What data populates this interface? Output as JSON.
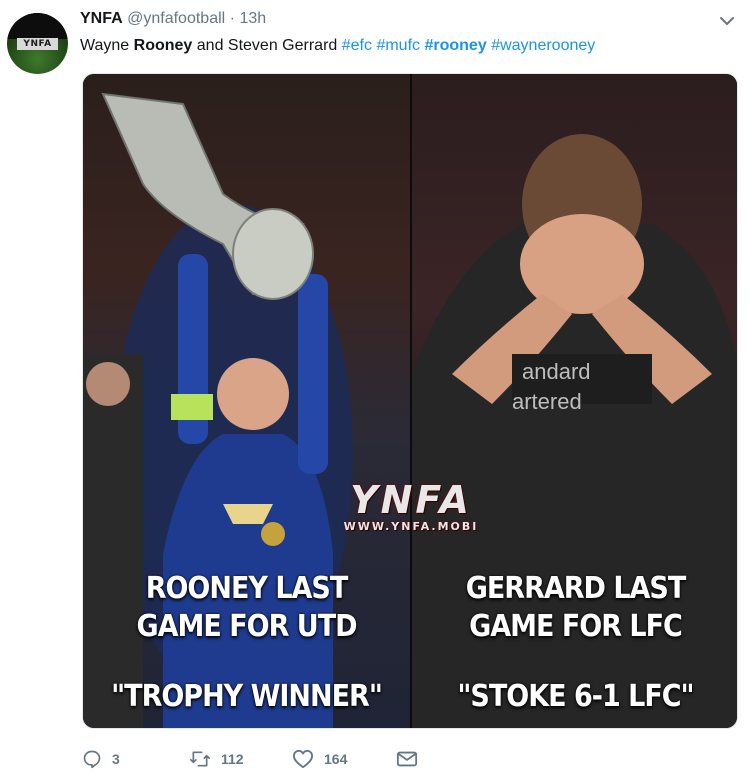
{
  "account": {
    "name": "YNFA",
    "handle": "@ynfafootball",
    "separator": "·",
    "time": "13h",
    "avatar_logo": "YNFA"
  },
  "tweet": {
    "text_plain_1": "Wayne ",
    "text_bold_1": "Rooney",
    "text_plain_2": " and Steven Gerrard ",
    "hashtags": [
      "#efc",
      "#mufc",
      "#rooney",
      "#waynerooney"
    ]
  },
  "media": {
    "left_caption_1": "ROONEY LAST",
    "left_caption_2": "GAME FOR UTD",
    "left_caption_3": "\"TROPHY WINNER\"",
    "right_caption_1": "GERRARD LAST",
    "right_caption_2": "GAME FOR LFC",
    "right_caption_3": "\"STOKE 6-1 LFC\"",
    "watermark_big": "YNFA",
    "watermark_small": "WWW.YNFA.MOBI"
  },
  "actions": {
    "reply_count": "3",
    "retweet_count": "112",
    "like_count": "164",
    "icons": [
      "reply-icon",
      "retweet-icon",
      "like-icon",
      "direct-message-icon"
    ]
  },
  "colors": {
    "link": "#1b95e0",
    "muted": "#657786",
    "text": "#14171a"
  }
}
